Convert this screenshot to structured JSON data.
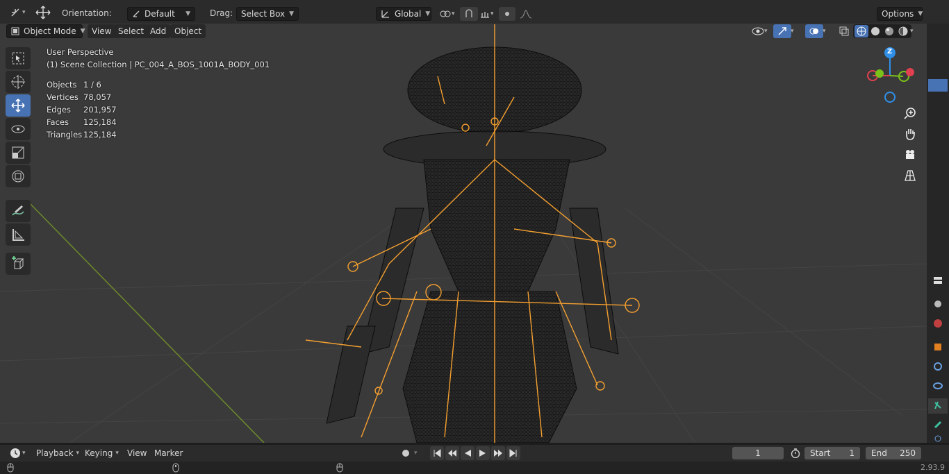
{
  "topbar": {
    "orientation_label": "Orientation:",
    "orientation_value": "Default",
    "drag_label": "Drag:",
    "drag_value": "Select Box",
    "transform_orientation": "Global",
    "options_label": "Options"
  },
  "header": {
    "mode": "Object Mode",
    "menus": [
      "View",
      "Select",
      "Add",
      "Object"
    ]
  },
  "overlay": {
    "view_name": "User Perspective",
    "collection": "(1) Scene Collection | PC_004_A_BOS_1001A_BODY_001",
    "stats": [
      {
        "label": "Objects",
        "value": "1 / 6"
      },
      {
        "label": "Vertices",
        "value": "78,057"
      },
      {
        "label": "Edges",
        "value": "201,957"
      },
      {
        "label": "Faces",
        "value": "125,184"
      },
      {
        "label": "Triangles",
        "value": "125,184"
      }
    ]
  },
  "gizmo": {
    "z_label": "Z"
  },
  "timeline": {
    "menus": [
      "Playback",
      "Keying",
      "View",
      "Marker"
    ],
    "current_frame": "1",
    "start_label": "Start",
    "start_value": "1",
    "end_label": "End",
    "end_value": "250"
  },
  "status": {
    "version": "2.93.9"
  },
  "colors": {
    "accent": "#4772b3",
    "bone": "#f5a030",
    "x_axis": "#e0404f",
    "y_axis": "#7ac21a",
    "z_axis": "#2f8fe8"
  },
  "icons": [
    "transform-icon",
    "move-icon",
    "snap-icon",
    "proportional-icon",
    "visibility-icon",
    "overlay-icon",
    "xray-icon",
    "shading-wireframe-icon",
    "shading-solid-icon",
    "shading-material-icon",
    "shading-rendered-icon",
    "zoom-icon",
    "hand-icon",
    "camera-icon",
    "grid-icon"
  ]
}
